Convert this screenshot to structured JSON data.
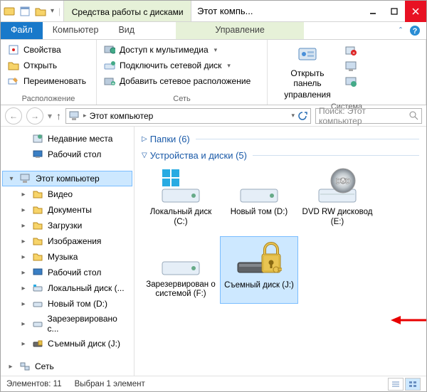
{
  "titlebar": {
    "tool_tab": "Средства работы с дисками",
    "app_title": "Этот компь..."
  },
  "tabs": {
    "file": "Файл",
    "computer": "Компьютер",
    "view": "Вид",
    "manage": "Управление"
  },
  "ribbon": {
    "properties": "Свойства",
    "open": "Открыть",
    "rename": "Переименовать",
    "group_location": "Расположение",
    "media_access": "Доступ к мультимедиа",
    "map_drive": "Подключить сетевой диск",
    "add_net_location": "Добавить сетевое расположение",
    "group_network": "Сеть",
    "open_cpl1": "Открыть панель",
    "open_cpl2": "управления",
    "group_system": "Система"
  },
  "address": {
    "path": "Этот компьютер",
    "search_placeholder": "Поиск: Этот компьютер"
  },
  "nav": {
    "recent": "Недавние места",
    "desktop": "Рабочий стол",
    "this_pc": "Этот компьютер",
    "video": "Видео",
    "documents": "Документы",
    "downloads": "Загрузки",
    "pictures": "Изображения",
    "music": "Музыка",
    "desktop2": "Рабочий стол",
    "local_c": "Локальный диск (...",
    "new_d": "Новый том (D:)",
    "reserved": "Зарезервировано с...",
    "removable_j": "Съемный диск (J:)",
    "network": "Сеть"
  },
  "content": {
    "group_folders": "Папки (6)",
    "group_devices": "Устройства и диски (5)",
    "drive_c": "Локальный диск (C:)",
    "drive_d": "Новый том (D:)",
    "drive_e": "DVD RW дисковод (E:)",
    "drive_f": "Зарезервирован о системой (F:)",
    "drive_j": "Съемный диск (J:)"
  },
  "status": {
    "items": "Элементов: 11",
    "selected": "Выбран 1 элемент"
  }
}
